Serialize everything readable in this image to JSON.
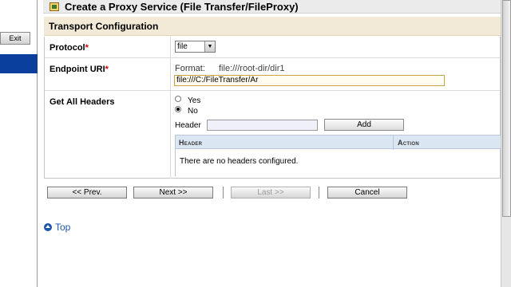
{
  "left_nav": {
    "exit_label": "Exit"
  },
  "header": {
    "title": "Create a Proxy Service (File Transfer/FileProxy)"
  },
  "transport": {
    "section_title": "Transport Configuration",
    "protocol": {
      "label": "Protocol",
      "required_mark": "*",
      "selected": "file"
    },
    "endpoint": {
      "label": "Endpoint URI",
      "required_mark": "*",
      "format_label": "Format:",
      "format_value": "file:///root-dir/dir1",
      "input_value": "file:///C:/FileTransfer/Ar"
    },
    "headers": {
      "label": "Get All Headers",
      "options": [
        "Yes",
        "No"
      ],
      "selected": "No",
      "header_field_label": "Header",
      "add_label": "Add",
      "table_columns": [
        "Header",
        "Action"
      ],
      "empty_message": "There are no headers configured."
    }
  },
  "navigation": {
    "prev_label": "<< Prev.",
    "next_label": "Next >>",
    "last_label": "Last >>",
    "cancel_label": "Cancel"
  },
  "footer": {
    "top_link": "Top"
  },
  "colors": {
    "nav_selected": "#0a3f9e",
    "section_bg": "#f2ead6",
    "table_header_bg": "#dbe6f3",
    "required": "#cc0000",
    "link": "#1d56a8"
  }
}
